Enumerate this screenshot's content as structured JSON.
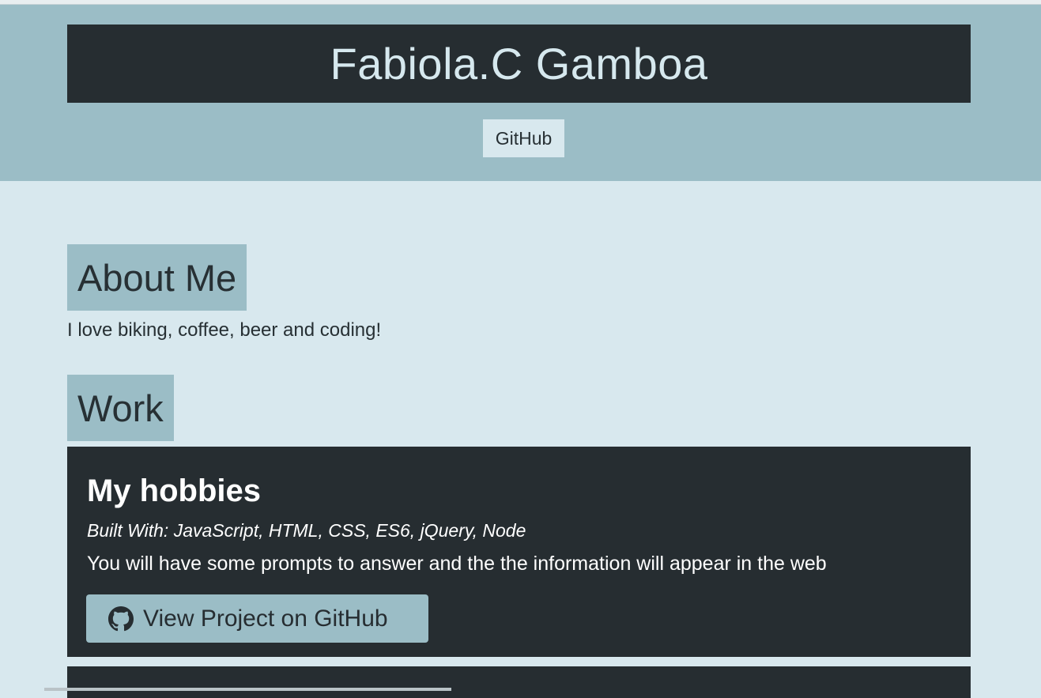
{
  "header": {
    "title": "Fabiola.C Gamboa",
    "nav_link": "GitHub"
  },
  "about": {
    "heading": "About Me",
    "text": "I love biking, coffee, beer and coding!"
  },
  "work": {
    "heading": "Work",
    "projects": [
      {
        "title": "My hobbies",
        "built_with": "Built With: JavaScript, HTML, CSS, ES6, jQuery, Node",
        "description": "You will have some prompts to answer and the the information will appear in the web",
        "button_label": "View Project on GitHub",
        "button_icon": "github-icon"
      }
    ]
  },
  "colors": {
    "page_bg": "#d8e8ee",
    "header_bg": "#9bbdc6",
    "dark": "#262d31",
    "title_text": "#d6e8ee"
  }
}
